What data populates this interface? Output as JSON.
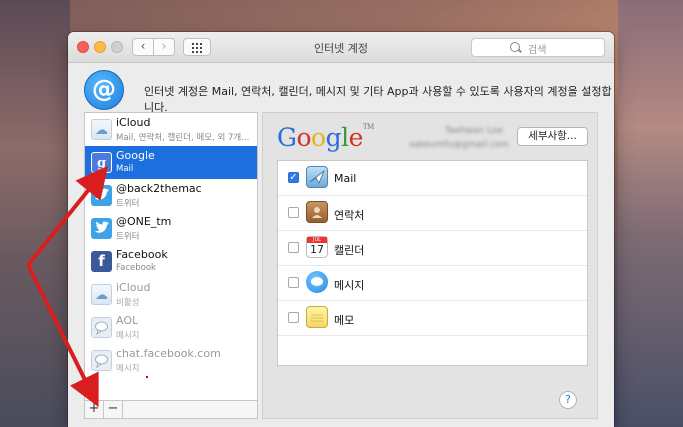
{
  "window": {
    "title": "인터넷 계정",
    "search_placeholder": "검색",
    "description": "인터넷 계정은 Mail, 연락처, 캘린더, 메시지 및 기타 App과 사용할 수 있도록 사용자의 계정을 설정합니다."
  },
  "header": {
    "icon_glyph": "@"
  },
  "sidebar": {
    "accounts": [
      {
        "name": "iCloud",
        "sub": "Mail, 연락처, 캘린더, 메모, 외 7개...",
        "icon": "icloud-icon",
        "glyph": "☁"
      },
      {
        "name": "Google",
        "sub": "Mail",
        "icon": "google-icon",
        "glyph": "g",
        "selected": true
      },
      {
        "name": "@back2themac",
        "sub": "트위터",
        "icon": "twitter-icon",
        "glyph": "🐦"
      },
      {
        "name": "@ONE_tm",
        "sub": "트위터",
        "icon": "twitter-icon",
        "glyph": "🐦"
      },
      {
        "name": "Facebook",
        "sub": "Facebook",
        "icon": "facebook-icon",
        "glyph": "f"
      },
      {
        "name": "iCloud",
        "sub": "비활성",
        "icon": "icloud-icon",
        "glyph": "☁",
        "dim": true
      },
      {
        "name": "AOL",
        "sub": "메시지",
        "icon": "aol-chat-icon",
        "glyph": "💬",
        "dim": true
      },
      {
        "name": "chat.facebook.com",
        "sub": "메시지",
        "icon": "chat-icon",
        "glyph": "💬",
        "dim": true
      }
    ],
    "add_label": "+",
    "remove_label": "−"
  },
  "detail": {
    "provider_logo": "Google",
    "account_name_blurred": "Taehwan Lee",
    "account_email_blurred": "sakeumfu@gmail.com",
    "details_button": "세부사항...",
    "services": [
      {
        "label": "Mail",
        "checked": true,
        "icon": "mail-app-icon"
      },
      {
        "label": "연락처",
        "checked": false,
        "icon": "contacts-app-icon"
      },
      {
        "label": "캘린더",
        "checked": false,
        "icon": "calendar-app-icon",
        "calendar_day": "17",
        "calendar_month": "JUL"
      },
      {
        "label": "메시지",
        "checked": false,
        "icon": "messages-app-icon"
      },
      {
        "label": "메모",
        "checked": false,
        "icon": "notes-app-icon"
      }
    ],
    "help_label": "?"
  },
  "colors": {
    "selection": "#1d6fdd",
    "annotation_arrow": "#d81e1e"
  }
}
